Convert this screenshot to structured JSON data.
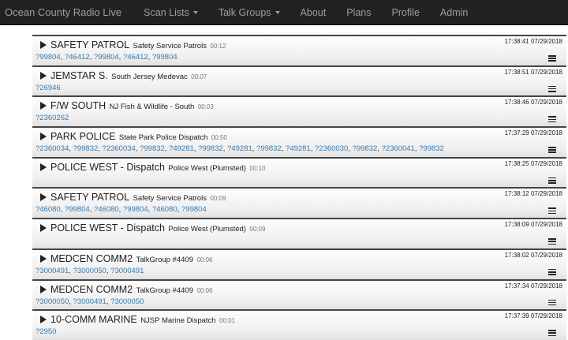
{
  "nav": {
    "brand": "Ocean County Radio Live",
    "items": [
      {
        "label": "Scan Lists",
        "dropdown": true
      },
      {
        "label": "Talk Groups",
        "dropdown": true
      },
      {
        "label": "About",
        "dropdown": false
      },
      {
        "label": "Plans",
        "dropdown": false
      },
      {
        "label": "Profile",
        "dropdown": false
      },
      {
        "label": "Admin",
        "dropdown": false
      }
    ]
  },
  "colors": {
    "navbar": "#222222",
    "link": "#337ab7"
  },
  "icons": {
    "play": "play-icon",
    "menu": "list-icon",
    "caret": "chevron-down-icon"
  },
  "calls": [
    {
      "name": "SAFETY PATROL",
      "desc": "Safety Service Patrols",
      "duration": "00:12",
      "timestamp": "17:38:41 07/29/2018",
      "units": [
        "?99804",
        "?46412",
        "?99804",
        "?46412",
        "?99804"
      ]
    },
    {
      "name": "JEMSTAR S.",
      "desc": "South Jersey Medevac",
      "duration": "00:07",
      "timestamp": "17:38:51 07/29/2018",
      "units": [
        "?26946"
      ]
    },
    {
      "name": "F/W SOUTH",
      "desc": "NJ Fish & Wildlife - South",
      "duration": "00:03",
      "timestamp": "17:38:46 07/29/2018",
      "units": [
        "?2360262"
      ]
    },
    {
      "name": "PARK POLICE",
      "desc": "State Park Police Dispatch",
      "duration": "00:50",
      "timestamp": "17:37:29 07/29/2018",
      "units": [
        "?2360034",
        "?99832",
        "?2360034",
        "?99832",
        "?49281",
        "?99832",
        "?49281",
        "?99832",
        "?49281",
        "?2360030",
        "?99832",
        "?2360041",
        "?99832"
      ]
    },
    {
      "name": "POLICE WEST - Dispatch",
      "desc": "Police West (Plumsted)",
      "duration": "00:10",
      "timestamp": "17:38:25 07/29/2018",
      "units": []
    },
    {
      "name": "SAFETY PATROL",
      "desc": "Safety Service Patrols",
      "duration": "00:09",
      "timestamp": "17:38:12 07/29/2018",
      "units": [
        "?46080",
        "?99804",
        "?46080",
        "?99804",
        "?46080",
        "?99804"
      ]
    },
    {
      "name": "POLICE WEST - Dispatch",
      "desc": "Police West (Plumsted)",
      "duration": "00:09",
      "timestamp": "17:38:09 07/29/2018",
      "units": []
    },
    {
      "name": "MEDCEN COMM2",
      "desc": "TalkGroup #4409",
      "duration": "00:06",
      "timestamp": "17:38:02 07/29/2018",
      "units": [
        "?3000491",
        "?3000050",
        "?3000491"
      ]
    },
    {
      "name": "MEDCEN COMM2",
      "desc": "TalkGroup #4409",
      "duration": "00:06",
      "timestamp": "17:37:34 07/29/2018",
      "units": [
        "?3000050",
        "?3000491",
        "?3000050"
      ]
    },
    {
      "name": "10-COMM MARINE",
      "desc": "NJSP Marine Dispatch",
      "duration": "00:01",
      "timestamp": "17:37:39 07/29/2018",
      "units": [
        "?2950"
      ]
    }
  ]
}
